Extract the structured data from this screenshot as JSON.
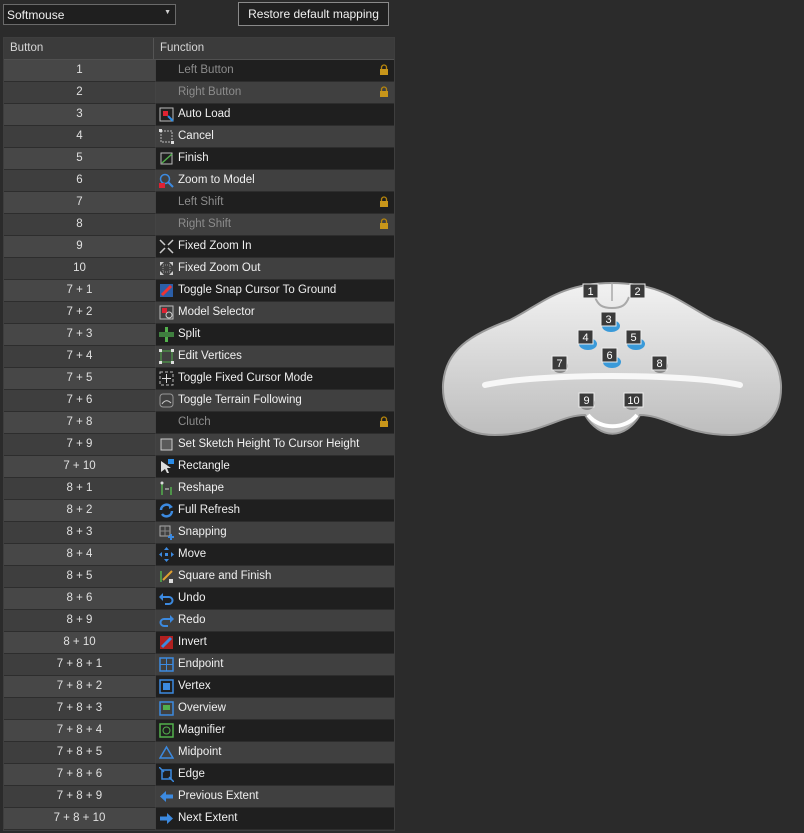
{
  "device_select": {
    "value": "Softmouse"
  },
  "restore_button": {
    "label": "Restore default mapping"
  },
  "table": {
    "headers": {
      "button": "Button",
      "function": "Function"
    },
    "rows": [
      {
        "button": "1",
        "function": "Left Button",
        "locked": true,
        "icon": "none"
      },
      {
        "button": "2",
        "function": "Right Button",
        "locked": true,
        "icon": "none"
      },
      {
        "button": "3",
        "function": "Auto Load",
        "locked": false,
        "icon": "auto-load-icon"
      },
      {
        "button": "4",
        "function": "Cancel",
        "locked": false,
        "icon": "cancel-icon"
      },
      {
        "button": "5",
        "function": "Finish",
        "locked": false,
        "icon": "finish-icon"
      },
      {
        "button": "6",
        "function": "Zoom to Model",
        "locked": false,
        "icon": "zoom-to-model-icon"
      },
      {
        "button": "7",
        "function": "Left Shift",
        "locked": true,
        "icon": "none"
      },
      {
        "button": "8",
        "function": "Right Shift",
        "locked": true,
        "icon": "none"
      },
      {
        "button": "9",
        "function": "Fixed Zoom In",
        "locked": false,
        "icon": "fixed-zoom-in-icon"
      },
      {
        "button": "10",
        "function": "Fixed Zoom Out",
        "locked": false,
        "icon": "fixed-zoom-out-icon"
      },
      {
        "button": "7 + 1",
        "function": "Toggle Snap Cursor To Ground",
        "locked": false,
        "icon": "snap-cursor-icon"
      },
      {
        "button": "7 + 2",
        "function": "Model Selector",
        "locked": false,
        "icon": "model-selector-icon"
      },
      {
        "button": "7 + 3",
        "function": "Split",
        "locked": false,
        "icon": "split-icon"
      },
      {
        "button": "7 + 4",
        "function": "Edit Vertices",
        "locked": false,
        "icon": "edit-vertices-icon"
      },
      {
        "button": "7 + 5",
        "function": "Toggle Fixed Cursor Mode",
        "locked": false,
        "icon": "fixed-cursor-icon"
      },
      {
        "button": "7 + 6",
        "function": "Toggle Terrain Following",
        "locked": false,
        "icon": "terrain-following-icon"
      },
      {
        "button": "7 + 8",
        "function": "Clutch",
        "locked": true,
        "icon": "none"
      },
      {
        "button": "7 + 9",
        "function": "Set Sketch Height To Cursor Height",
        "locked": false,
        "icon": "sketch-height-icon"
      },
      {
        "button": "7 + 10",
        "function": "Rectangle",
        "locked": false,
        "icon": "rectangle-icon"
      },
      {
        "button": "8 + 1",
        "function": "Reshape",
        "locked": false,
        "icon": "reshape-icon"
      },
      {
        "button": "8 + 2",
        "function": "Full Refresh",
        "locked": false,
        "icon": "full-refresh-icon"
      },
      {
        "button": "8 + 3",
        "function": "Snapping",
        "locked": false,
        "icon": "snapping-icon"
      },
      {
        "button": "8 + 4",
        "function": "Move",
        "locked": false,
        "icon": "move-icon"
      },
      {
        "button": "8 + 5",
        "function": "Square and Finish",
        "locked": false,
        "icon": "square-finish-icon"
      },
      {
        "button": "8 + 6",
        "function": "Undo",
        "locked": false,
        "icon": "undo-icon"
      },
      {
        "button": "8 + 9",
        "function": "Redo",
        "locked": false,
        "icon": "redo-icon"
      },
      {
        "button": "8 + 10",
        "function": "Invert",
        "locked": false,
        "icon": "invert-icon"
      },
      {
        "button": "7 + 8 + 1",
        "function": "Endpoint",
        "locked": false,
        "icon": "endpoint-icon"
      },
      {
        "button": "7 + 8 + 2",
        "function": "Vertex",
        "locked": false,
        "icon": "vertex-icon"
      },
      {
        "button": "7 + 8 + 3",
        "function": "Overview",
        "locked": false,
        "icon": "overview-icon"
      },
      {
        "button": "7 + 8 + 4",
        "function": "Magnifier",
        "locked": false,
        "icon": "magnifier-icon"
      },
      {
        "button": "7 + 8 + 5",
        "function": "Midpoint",
        "locked": false,
        "icon": "midpoint-icon"
      },
      {
        "button": "7 + 8 + 6",
        "function": "Edge",
        "locked": false,
        "icon": "edge-icon"
      },
      {
        "button": "7 + 8 + 9",
        "function": "Previous Extent",
        "locked": false,
        "icon": "previous-extent-icon"
      },
      {
        "button": "7 + 8 + 10",
        "function": "Next Extent",
        "locked": false,
        "icon": "next-extent-icon"
      }
    ]
  },
  "device_labels": [
    "1",
    "2",
    "3",
    "4",
    "5",
    "6",
    "7",
    "8",
    "9",
    "10"
  ]
}
